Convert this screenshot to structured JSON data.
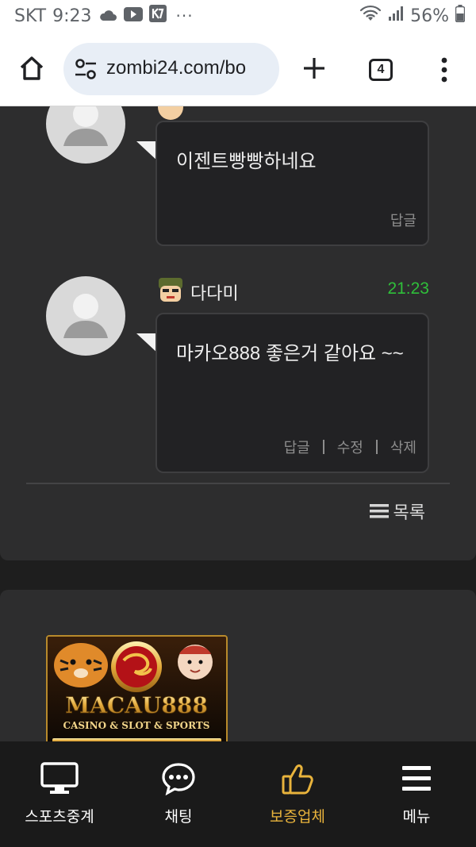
{
  "status_bar": {
    "carrier": "SKT",
    "time": "9:23",
    "more": "···",
    "battery": "56%",
    "icons": [
      "cloud-icon",
      "youtube-icon",
      "kakao-icon",
      "wifi-icon",
      "signal-icon",
      "battery-icon"
    ]
  },
  "browser": {
    "url": "zombi24.com/bo",
    "tab_count": "4",
    "icons": [
      "home-icon",
      "tune-icon",
      "plus-icon",
      "more-vert-icon"
    ]
  },
  "comments": [
    {
      "text": "이젠트빵빵하네요",
      "actions": [
        "답글"
      ]
    },
    {
      "author": "다다미",
      "time": "21:23",
      "text": "마카오888  좋은거 같아요 ~~",
      "actions": [
        "답글",
        "수정",
        "삭제"
      ]
    }
  ],
  "list_button": "목록",
  "banner": {
    "brand": "MACAU888",
    "tagline": "CASINO & SLOT & SPORTS"
  },
  "bottom_nav": [
    {
      "label": "스포츠중계",
      "icon": "monitor-icon"
    },
    {
      "label": "채팅",
      "icon": "chat-icon"
    },
    {
      "label": "보증업체",
      "icon": "thumbs-up-icon",
      "active": true
    },
    {
      "label": "메뉴",
      "icon": "menu-icon"
    }
  ],
  "colors": {
    "accent": "#e8b33c",
    "time_green": "#2fbf3a",
    "panel": "#2d2d2e",
    "background": "#1e1e1e"
  }
}
